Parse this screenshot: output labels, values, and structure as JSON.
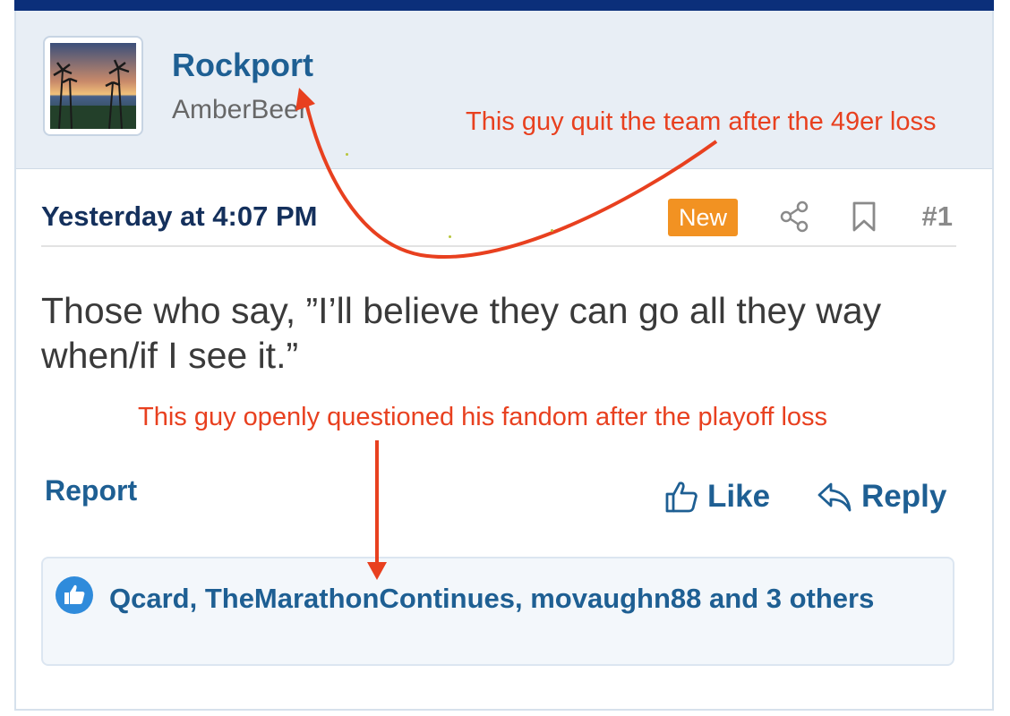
{
  "post": {
    "username": "Rockport",
    "user_title": "AmberBeer",
    "timestamp": "Yesterday at 4:07 PM",
    "new_badge": "New",
    "post_number": "#1",
    "body_line_1": "Those who say, ”I’ll believe they can go all they way",
    "body_line_2": "when/if I see it.”",
    "report_label": "Report",
    "like_label": "Like",
    "reply_label": "Reply",
    "reactions_text": "Qcard, TheMarathonContinues, movaughn88 and 3 others"
  },
  "annotations": {
    "note_1": "This guy quit the team after the 49er loss",
    "note_2": "This guy openly questioned his fandom after the playoff loss"
  },
  "icons": {
    "share": "share-icon",
    "bookmark": "bookmark-icon",
    "like": "thumbs-up-icon",
    "reply": "reply-arrow-icon",
    "reactions": "like-reaction-icon"
  },
  "colors": {
    "accent_blue": "#1e5f93",
    "new_badge": "#f29222",
    "annotation_red": "#e8401f",
    "header_bg": "#e8eef5"
  }
}
